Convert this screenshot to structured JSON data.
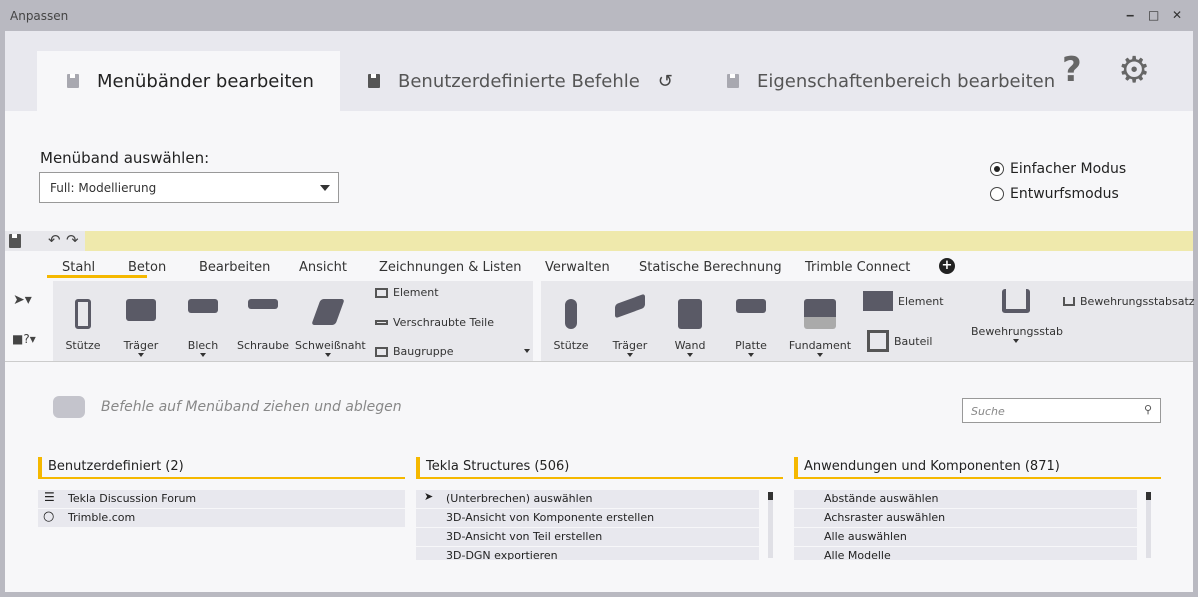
{
  "window": {
    "title": "Anpassen",
    "minimize": "‒",
    "maximize": "□",
    "close": "✕"
  },
  "tabs": [
    {
      "label": "Menübänder bearbeiten"
    },
    {
      "label": "Benutzerdefinierte Befehle"
    },
    {
      "label": "Eigenschaftenbereich bearbeiten"
    }
  ],
  "header_icons": {
    "help": "?",
    "settings": "⚙",
    "reset": "↺"
  },
  "ribbon_select": {
    "label": "Menüband auswählen:",
    "value": "Full: Modellierung"
  },
  "modes": [
    {
      "label": "Einfacher Modus",
      "selected": true
    },
    {
      "label": "Entwurfsmodus",
      "selected": false
    }
  ],
  "qat": {
    "undo": "↶",
    "redo": "↷"
  },
  "ribbon_tabs": [
    "Stahl",
    "Beton",
    "Bearbeiten",
    "Ansicht",
    "Zeichnungen & Listen",
    "Verwalten",
    "Statische Berechnung",
    "Trimble Connect"
  ],
  "steel": {
    "buttons": [
      "Stütze",
      "Träger",
      "Blech",
      "Schraube",
      "Schweißnaht"
    ],
    "small": [
      "Element",
      "Verschraubte Teile",
      "Baugruppe"
    ]
  },
  "concrete": {
    "buttons": [
      "Stütze",
      "Träger",
      "Wand",
      "Platte",
      "Fundament"
    ],
    "small": [
      "Element",
      "Bauteil"
    ],
    "rebar": "Bewehrungsstab",
    "rebar_set": "Bewehrungsstabsatz"
  },
  "hint": "Befehle auf Menüband ziehen und ablegen",
  "search": {
    "placeholder": "Suche"
  },
  "sections": [
    {
      "title": "Benutzerdefiniert (2)",
      "items": [
        "Tekla Discussion Forum",
        "Trimble.com"
      ]
    },
    {
      "title": "Tekla Structures (506)",
      "items": [
        "(Unterbrechen) auswählen",
        "3D-Ansicht von Komponente erstellen",
        "3D-Ansicht von Teil erstellen",
        "3D-DGN exportieren"
      ]
    },
    {
      "title": "Anwendungen und Komponenten (871)",
      "items": [
        "Abstände auswählen",
        "Achsraster auswählen",
        "Alle auswählen",
        "Alle Modelle"
      ]
    }
  ],
  "colors": {
    "accent": "#f5b800",
    "qat": "#efe9ac"
  }
}
